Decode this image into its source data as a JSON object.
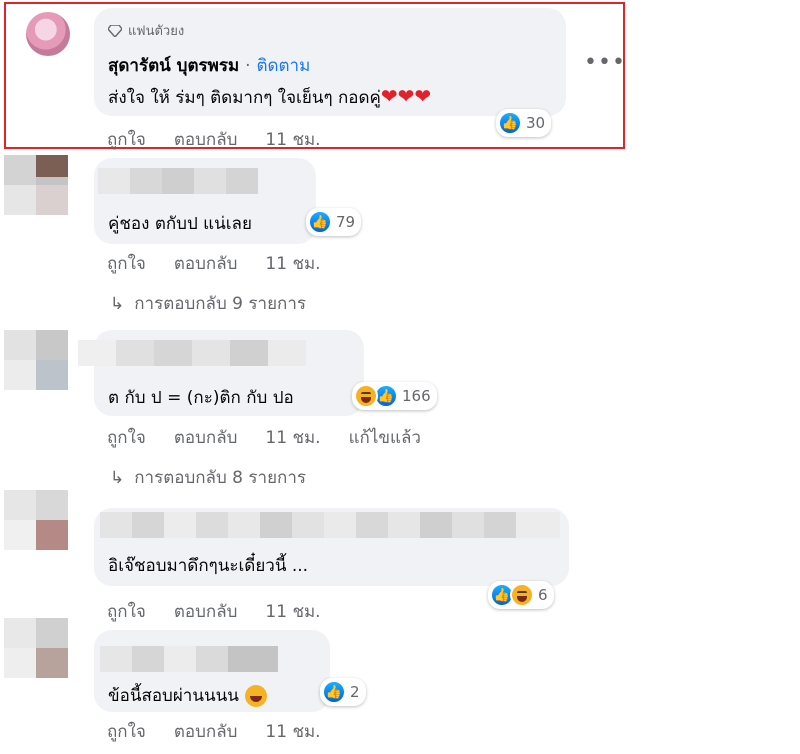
{
  "comments": [
    {
      "badge": "แฟนตัวยง",
      "author": "สุดารัตน์ บุตรพรม",
      "separator": "·",
      "follow": "ติดตาม",
      "text": "ส่งใจ ให้ ร่มๆ ติดมากๆ ใจเย็นๆ กอดคู่",
      "hearts": "❤❤❤",
      "like_label": "ถูกใจ",
      "reply_label": "ตอบกลับ",
      "time": "11 ชม.",
      "reaction_count": "30",
      "more": "•••"
    },
    {
      "text": "คู่ชอง ตกับป แน่เลย",
      "like_label": "ถูกใจ",
      "reply_label": "ตอบกลับ",
      "time": "11 ชม.",
      "reaction_count": "79",
      "replies": "การตอบกลับ 9 รายการ"
    },
    {
      "text": "ต กับ ป = (กะ)ติก กับ ปอ",
      "like_label": "ถูกใจ",
      "reply_label": "ตอบกลับ",
      "time": "11 ชม.",
      "edited": "แก้ไขแล้ว",
      "reaction_count": "166",
      "replies": "การตอบกลับ 8 รายการ"
    },
    {
      "text": "อิเจ๊ชอบมาดึกๆนะเดี๋ยวนี้ ...",
      "like_label": "ถูกใจ",
      "reply_label": "ตอบกลับ",
      "time": "11 ชม.",
      "reaction_count": "6"
    },
    {
      "text": "ข้อนี้สอบผ่านนนน",
      "like_label": "ถูกใจ",
      "reply_label": "ตอบกลับ",
      "time": "11 ชม.",
      "reaction_count": "2"
    }
  ],
  "icons": {
    "like": "thumbs-up-icon",
    "haha": "haha-icon",
    "reply_arrow": "reply-arrow-icon",
    "badge": "diamond-icon",
    "more": "more-options-icon"
  },
  "colors": {
    "highlight": "#e0242a",
    "accent": "#1877f2",
    "bubble": "#f0f2f5",
    "muted": "#65676b"
  }
}
